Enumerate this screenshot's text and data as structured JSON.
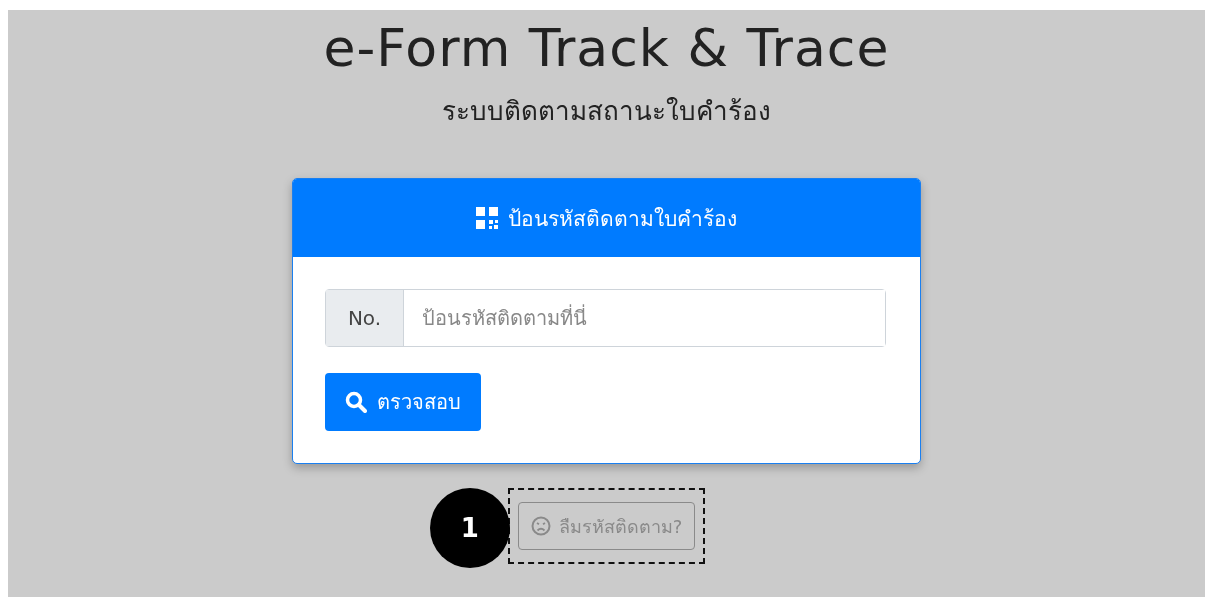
{
  "title": "e-Form Track & Trace",
  "subtitle": "ระบบติดตามสถานะใบคำร้อง",
  "card": {
    "header": "ป้อนรหัสติดตามใบคำร้อง",
    "input": {
      "prefix": "No.",
      "placeholder": "ป้อนรหัสติดตามที่นี่"
    },
    "submit": "ตรวจสอบ"
  },
  "forgot_button": {
    "label": "ลืมรหัสติดตาม?",
    "disabled": true
  },
  "callout": {
    "number": "1"
  }
}
